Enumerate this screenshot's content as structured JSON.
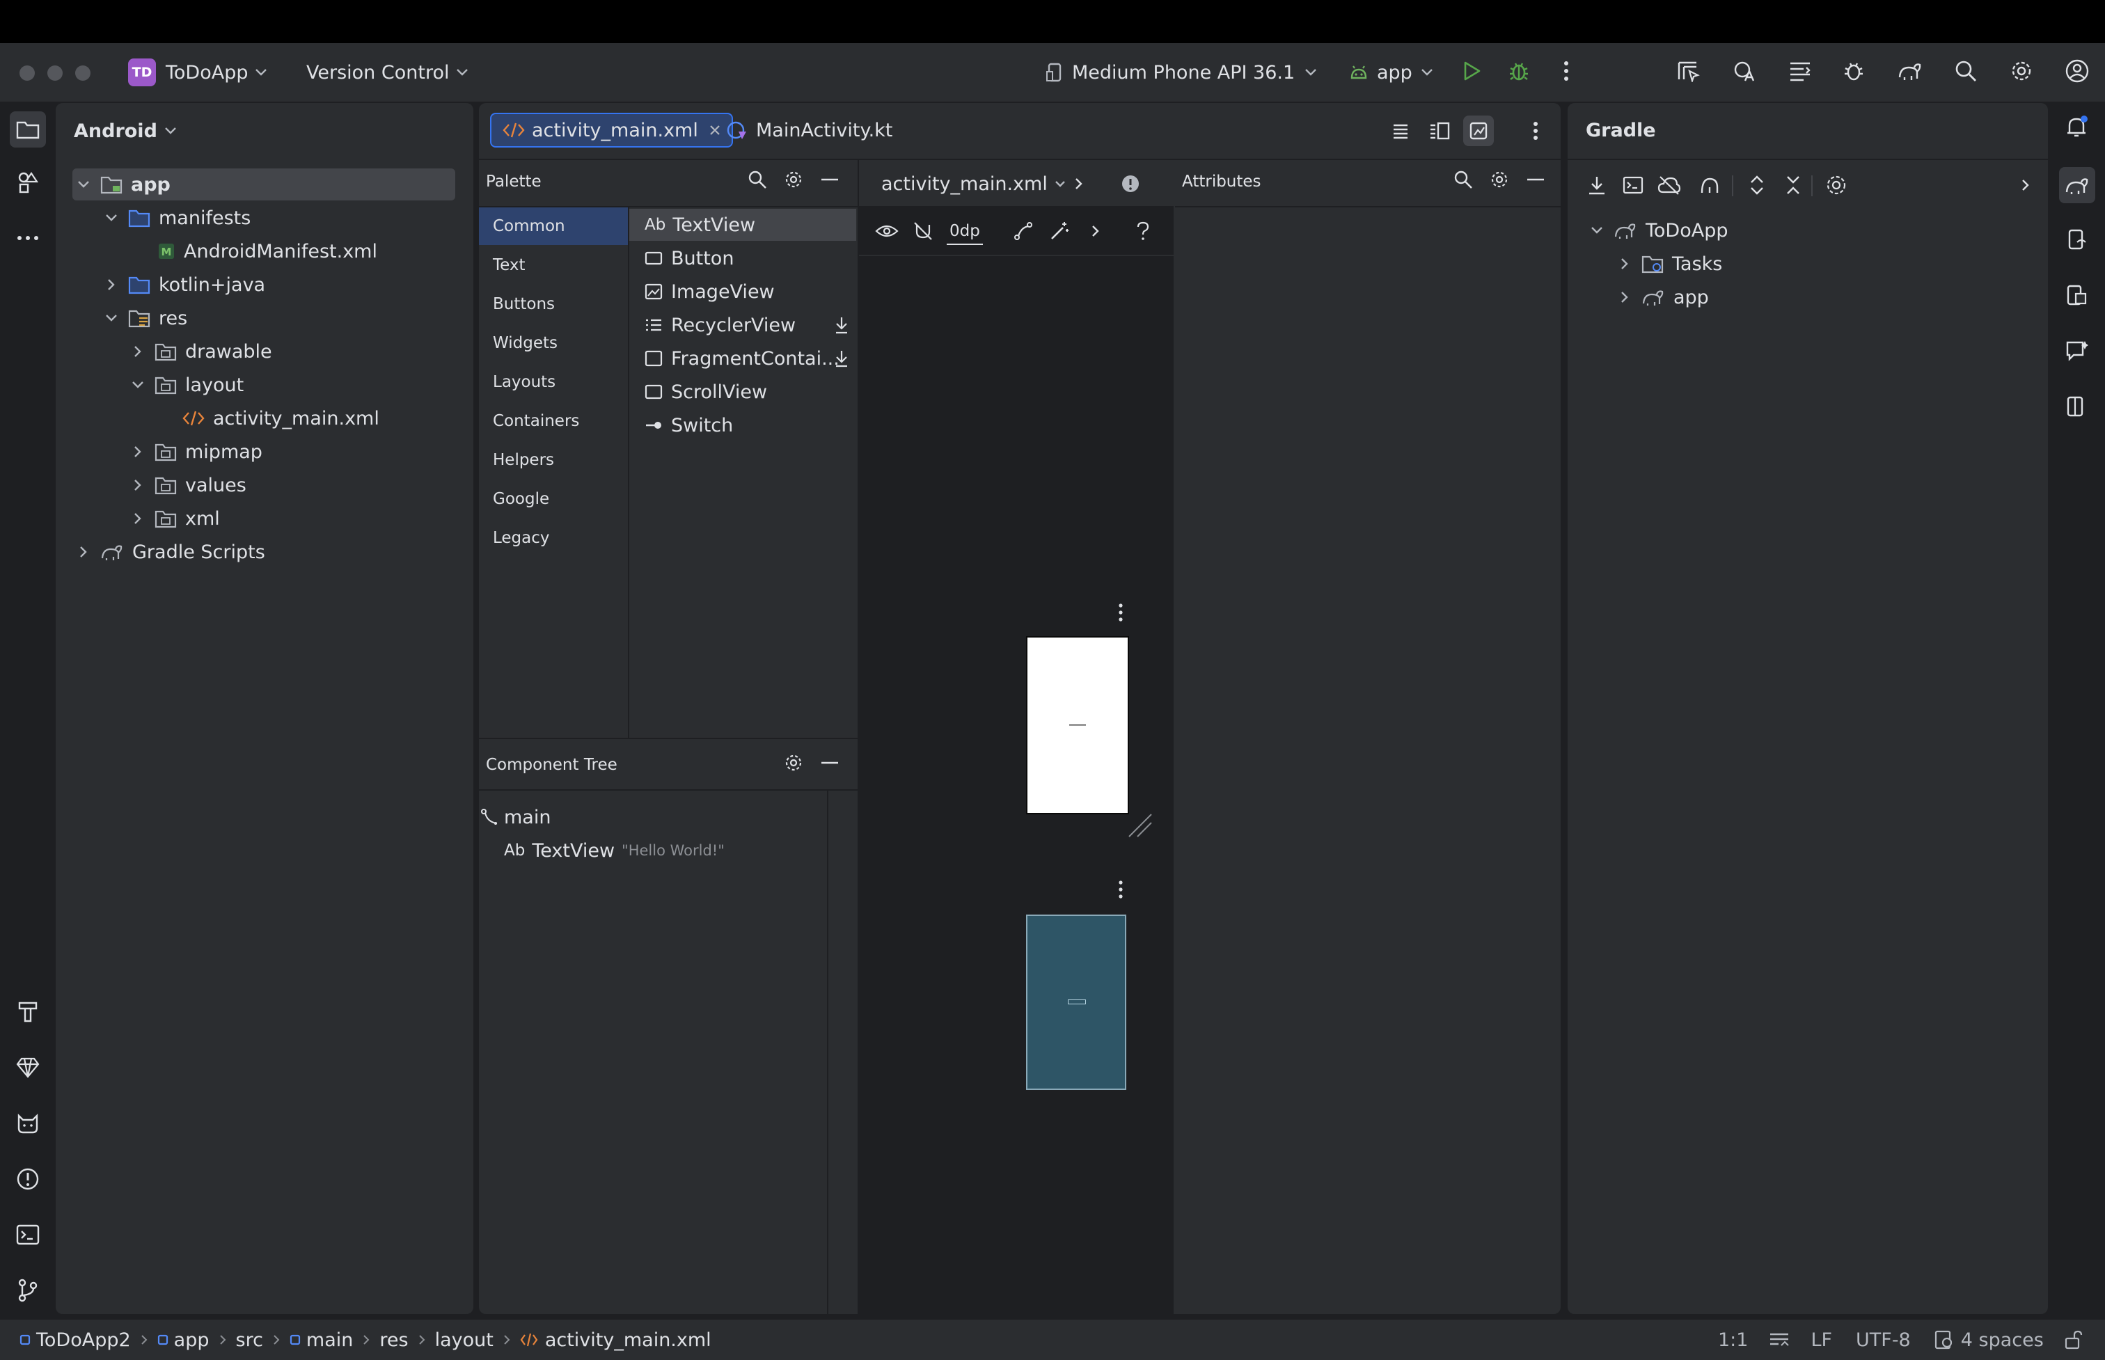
{
  "titlebar": {
    "project_badge": "TD",
    "project_name": "ToDoApp",
    "vcs_label": "Version Control",
    "device_label": "Medium Phone API 36.1",
    "run_config": "app"
  },
  "project_panel": {
    "view_label": "Android",
    "tree": [
      {
        "label": "app",
        "bold": true
      },
      {
        "label": "manifests"
      },
      {
        "label": "AndroidManifest.xml"
      },
      {
        "label": "kotlin+java"
      },
      {
        "label": "res"
      },
      {
        "label": "drawable"
      },
      {
        "label": "layout"
      },
      {
        "label": "activity_main.xml"
      },
      {
        "label": "mipmap"
      },
      {
        "label": "values"
      },
      {
        "label": "xml"
      },
      {
        "label": "Gradle Scripts"
      }
    ]
  },
  "editor": {
    "tabs": [
      {
        "label": "activity_main.xml",
        "active": true
      },
      {
        "label": "MainActivity.kt",
        "active": false
      }
    ],
    "design_file": "activity_main.xml",
    "dp_value": "0dp"
  },
  "palette": {
    "title": "Palette",
    "categories": [
      "Common",
      "Text",
      "Buttons",
      "Widgets",
      "Layouts",
      "Containers",
      "Helpers",
      "Google",
      "Legacy"
    ],
    "items": [
      {
        "label": "TextView",
        "icon": "Ab"
      },
      {
        "label": "Button",
        "icon": "button-icon"
      },
      {
        "label": "ImageView",
        "icon": "image-icon"
      },
      {
        "label": "RecyclerView",
        "icon": "list-icon"
      },
      {
        "label": "FragmentContai...",
        "icon": "fragment-icon"
      },
      {
        "label": "ScrollView",
        "icon": "scroll-icon"
      },
      {
        "label": "Switch",
        "icon": "switch-icon"
      }
    ]
  },
  "component_tree": {
    "title": "Component Tree",
    "root": "main",
    "child_icon": "Ab",
    "child_label": "TextView",
    "child_value": "\"Hello World!\""
  },
  "attributes": {
    "title": "Attributes"
  },
  "gradle": {
    "title": "Gradle",
    "tree": [
      "ToDoApp",
      "Tasks",
      "app"
    ]
  },
  "statusbar": {
    "breadcrumbs": [
      "ToDoApp2",
      "app",
      "src",
      "main",
      "res",
      "layout",
      "activity_main.xml"
    ],
    "position": "1:1",
    "line_sep": "LF",
    "encoding": "UTF-8",
    "indent": "4 spaces"
  },
  "colors": {
    "accent": "#3574f0",
    "selection": "#2e436e",
    "panel": "#2b2d30",
    "background": "#1e1f22",
    "blueprint": "#2e5566"
  }
}
